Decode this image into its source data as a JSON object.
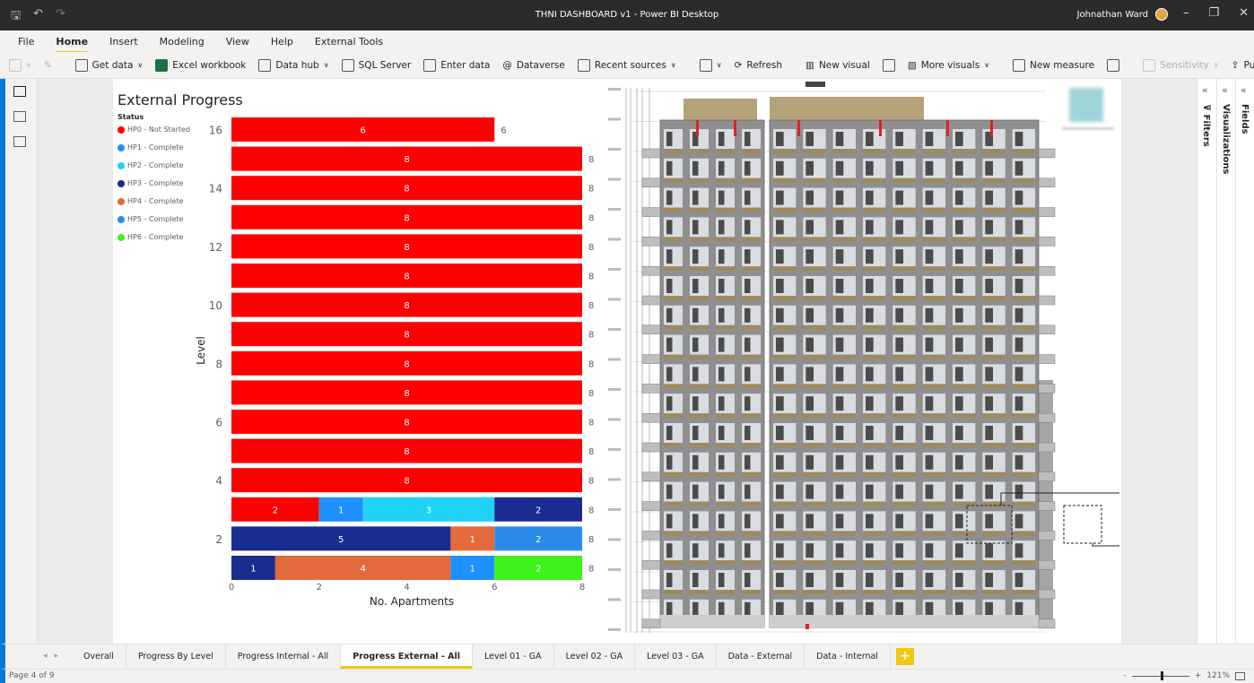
{
  "titlebar": {
    "title": "THNI DASHBOARD v1 - Power BI Desktop",
    "user": "Johnathan Ward",
    "icons": [
      "save-icon",
      "undo-icon",
      "redo-icon"
    ],
    "window_controls": {
      "minimize": "–",
      "restore": "❐",
      "close": "✕"
    }
  },
  "menu": [
    "File",
    "Home",
    "Insert",
    "Modeling",
    "View",
    "Help",
    "External Tools"
  ],
  "menu_active": "Home",
  "ribbon": {
    "get_data": "Get data",
    "excel": "Excel workbook",
    "data_hub": "Data hub",
    "sql": "SQL Server",
    "enter_data": "Enter data",
    "dataverse": "Dataverse",
    "recent": "Recent sources",
    "refresh": "Refresh",
    "new_visual": "New visual",
    "more_visuals": "More visuals",
    "new_measure": "New measure",
    "sensitivity": "Sensitivity",
    "publish": "Publish"
  },
  "chart_data": {
    "type": "bar",
    "orientation": "horizontal-stacked",
    "title": "External Progress",
    "legend_title": "Status",
    "xlabel": "No. Apartments",
    "ylabel": "Level",
    "xlim": [
      0,
      8
    ],
    "x_ticks": [
      "0",
      "2",
      "4",
      "6",
      "8"
    ],
    "y_tick_labels": [
      "16",
      "",
      "14",
      "",
      "12",
      "",
      "10",
      "",
      "8",
      "",
      "6",
      "",
      "4",
      "",
      "2",
      ""
    ],
    "series": [
      {
        "name": "HP0 - Not Started",
        "color": "#ff0000"
      },
      {
        "name": "HP1 - Complete",
        "color": "#1e90ff"
      },
      {
        "name": "HP2 - Complete",
        "color": "#1ed3f5"
      },
      {
        "name": "HP3 - Complete",
        "color": "#1a2c8f"
      },
      {
        "name": "HP4 - Complete",
        "color": "#e26a3c"
      },
      {
        "name": "HP5 - Complete",
        "color": "#2a8ce6"
      },
      {
        "name": "HP6 - Complete",
        "color": "#3df31a"
      }
    ],
    "rows": [
      {
        "level": "16",
        "total": 6,
        "segments": [
          {
            "s": 0,
            "v": 6
          }
        ]
      },
      {
        "level": "15",
        "total": 8,
        "segments": [
          {
            "s": 0,
            "v": 8
          }
        ]
      },
      {
        "level": "14",
        "total": 8,
        "segments": [
          {
            "s": 0,
            "v": 8
          }
        ]
      },
      {
        "level": "13",
        "total": 8,
        "segments": [
          {
            "s": 0,
            "v": 8
          }
        ]
      },
      {
        "level": "12",
        "total": 8,
        "segments": [
          {
            "s": 0,
            "v": 8
          }
        ]
      },
      {
        "level": "11",
        "total": 8,
        "segments": [
          {
            "s": 0,
            "v": 8
          }
        ]
      },
      {
        "level": "10",
        "total": 8,
        "segments": [
          {
            "s": 0,
            "v": 8
          }
        ]
      },
      {
        "level": "9",
        "total": 8,
        "segments": [
          {
            "s": 0,
            "v": 8
          }
        ]
      },
      {
        "level": "8",
        "total": 8,
        "segments": [
          {
            "s": 0,
            "v": 8
          }
        ]
      },
      {
        "level": "7",
        "total": 8,
        "segments": [
          {
            "s": 0,
            "v": 8
          }
        ]
      },
      {
        "level": "6",
        "total": 8,
        "segments": [
          {
            "s": 0,
            "v": 8
          }
        ]
      },
      {
        "level": "5",
        "total": 8,
        "segments": [
          {
            "s": 0,
            "v": 8
          }
        ]
      },
      {
        "level": "4",
        "total": 8,
        "segments": [
          {
            "s": 0,
            "v": 8
          }
        ]
      },
      {
        "level": "3",
        "total": 8,
        "segments": [
          {
            "s": 0,
            "v": 2
          },
          {
            "s": 1,
            "v": 1
          },
          {
            "s": 2,
            "v": 3
          },
          {
            "s": 3,
            "v": 2
          }
        ]
      },
      {
        "level": "2",
        "total": 8,
        "segments": [
          {
            "s": 3,
            "v": 5
          },
          {
            "s": 4,
            "v": 1
          },
          {
            "s": 5,
            "v": 2
          }
        ]
      },
      {
        "level": "1",
        "total": 8,
        "segments": [
          {
            "s": 3,
            "v": 1
          },
          {
            "s": 4,
            "v": 4
          },
          {
            "s": 1,
            "v": 1
          },
          {
            "s": 6,
            "v": 2
          }
        ]
      }
    ]
  },
  "right_panes": {
    "filters": "Filters",
    "visualizations": "Visualizations",
    "fields": "Fields"
  },
  "tabs": [
    "Overall",
    "Progress By Level",
    "Progress Internal - All",
    "Progress External - All",
    "Level 01 - GA",
    "Level 02 - GA",
    "Level 03 - GA",
    "Data - External",
    "Data - Internal"
  ],
  "active_tab": "Progress External - All",
  "add_tab": "+",
  "status": {
    "page": "Page 4 of 9",
    "zoom": "121%",
    "zoom_minus": "-",
    "zoom_plus": "+"
  }
}
